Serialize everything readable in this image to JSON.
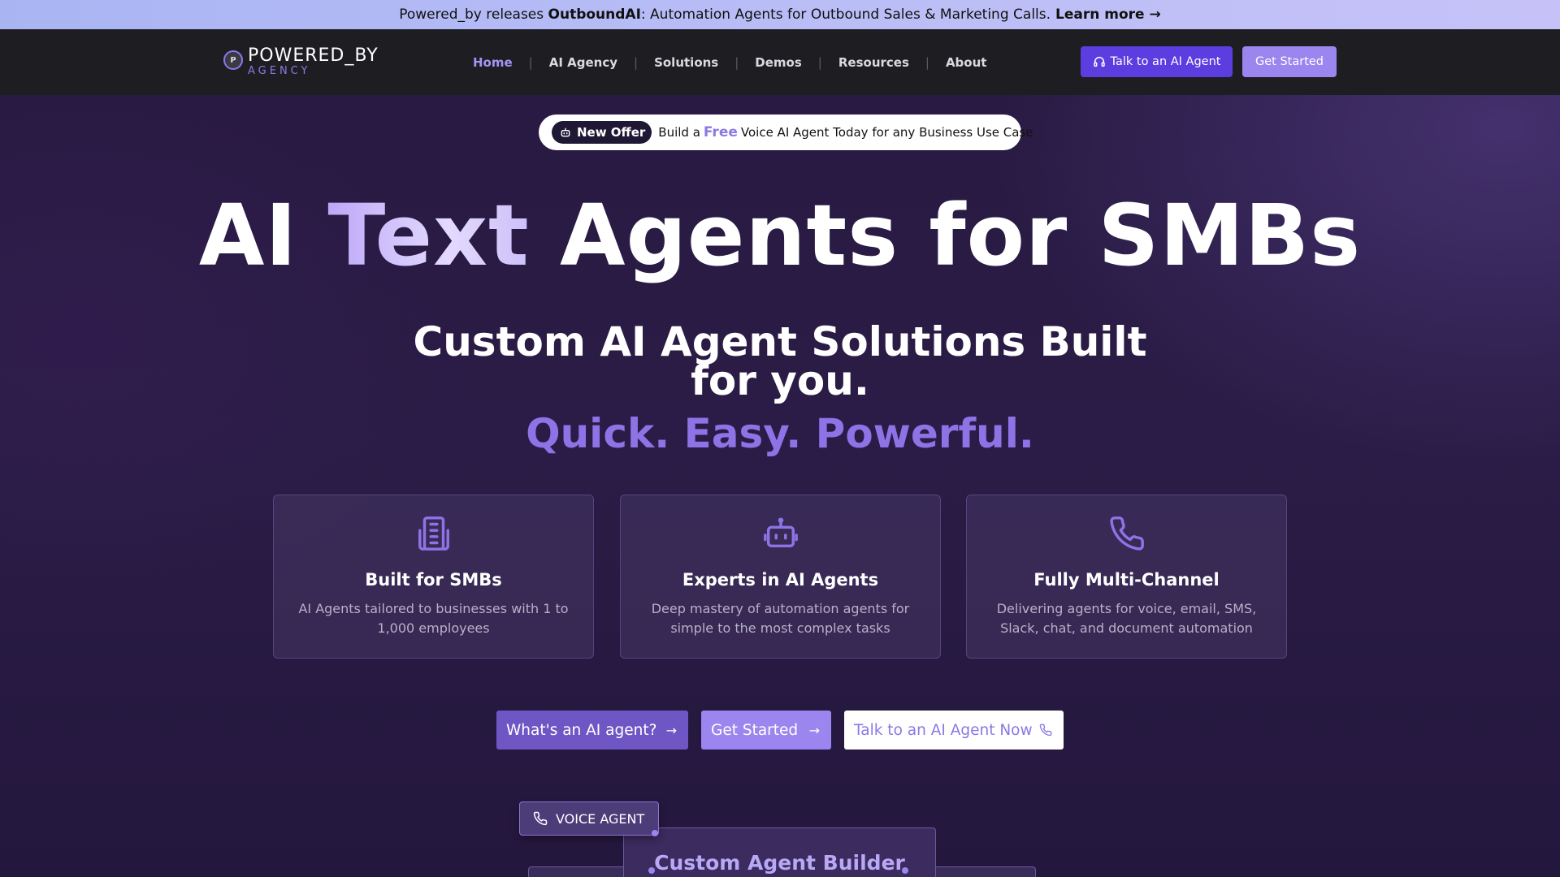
{
  "announcement": {
    "prefix": "Powered_by releases",
    "product": "OutboundAI",
    "suffix": ": Automation Agents for Outbound Sales & Marketing Calls.",
    "link": "Learn more →"
  },
  "logo": {
    "mark": "P",
    "main": "POWERED_BY",
    "sub": "AGENCY"
  },
  "nav": {
    "items": [
      {
        "label": "Home",
        "active": true
      },
      {
        "label": "AI Agency"
      },
      {
        "label": "Solutions"
      },
      {
        "label": "Demos"
      },
      {
        "label": "Resources"
      },
      {
        "label": "About"
      }
    ],
    "separator": "|",
    "talk_button": "Talk to an AI Agent",
    "start_button": "Get Started"
  },
  "offer": {
    "badge": "New Offer",
    "pre": "Build a",
    "highlight": "Free",
    "post": "Voice AI Agent Today for any Business Use Case"
  },
  "hero": {
    "title_pre": "AI",
    "title_highlight": "Text",
    "title_post": "Agents for SMBs",
    "subtitle": "Custom AI Agent Solutions Built for you.",
    "tagline": "Quick. Easy. Powerful."
  },
  "features": [
    {
      "icon": "building-icon",
      "title": "Built for SMBs",
      "desc": "AI Agents tailored to businesses with 1 to 1,000 employees"
    },
    {
      "icon": "robot-icon",
      "title": "Experts in AI Agents",
      "desc": "Deep mastery of automation agents for simple to the most complex tasks"
    },
    {
      "icon": "phone-icon",
      "title": "Fully Multi-Channel",
      "desc": "Delivering agents for voice, email, SMS, Slack, chat, and document automation"
    }
  ],
  "cta": {
    "what": "What's an AI agent?",
    "start": "Get Started",
    "talk": "Talk to an AI Agent Now"
  },
  "diagram": {
    "chip": "VOICE AGENT",
    "builder": "Custom Agent Builder"
  },
  "colors": {
    "accent": "#5b3de0",
    "accent_light": "#9a86ee",
    "highlight_purple": "#8c78e6",
    "background": "#281a42"
  }
}
